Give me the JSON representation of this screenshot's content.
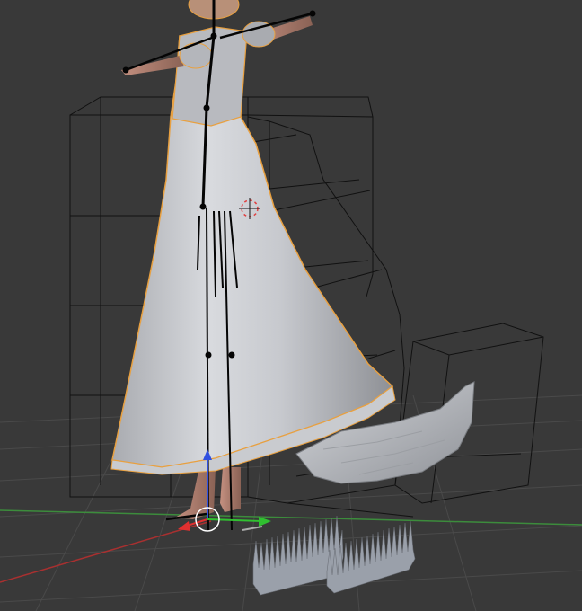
{
  "viewport": {
    "editor": "3D Viewport",
    "background_color": "#393939",
    "grid_color": "#4a4a4a",
    "x_axis_color": "#b03030",
    "y_axis_color": "#3a9a3a",
    "selection_outline_color": "#e8a040",
    "wire_color": "#111111",
    "bone_color": "#050505"
  },
  "scene": {
    "objects": [
      {
        "name": "character-head",
        "type": "mesh"
      },
      {
        "name": "dress",
        "type": "mesh",
        "selected": true
      },
      {
        "name": "tail",
        "type": "mesh"
      },
      {
        "name": "armature",
        "type": "armature"
      },
      {
        "name": "mesh-deform-cage",
        "type": "lattice-wireframe"
      },
      {
        "name": "tail-cage",
        "type": "lattice-wireframe"
      },
      {
        "name": "spike-strips",
        "type": "mesh"
      }
    ],
    "gizmo": {
      "mode": "translate",
      "axes": [
        {
          "axis": "x",
          "color": "#e03030"
        },
        {
          "axis": "y",
          "color": "#30c030"
        },
        {
          "axis": "z",
          "color": "#3050e0"
        }
      ]
    },
    "cursor_3d": {
      "visible": true,
      "color": "#e04040"
    }
  }
}
